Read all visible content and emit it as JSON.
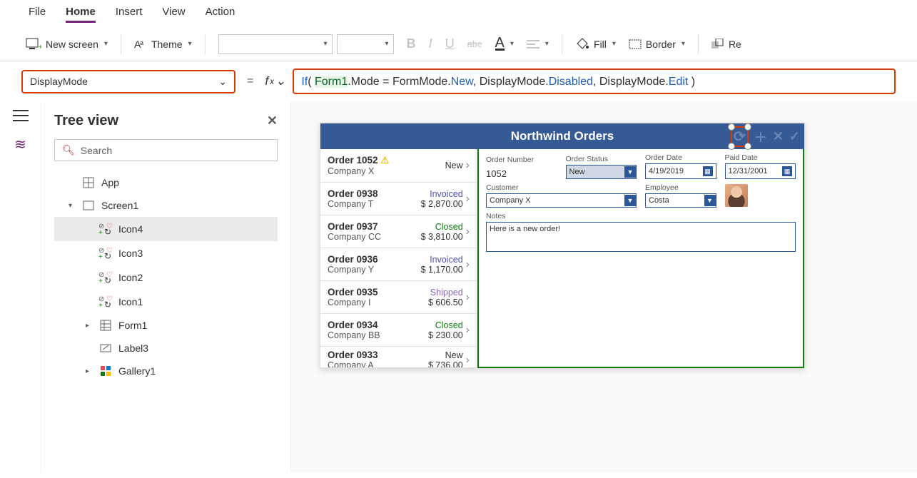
{
  "menu": {
    "items": [
      "File",
      "Home",
      "Insert",
      "View",
      "Action"
    ],
    "activeIndex": 1
  },
  "ribbon": {
    "newScreen": "New screen",
    "theme": "Theme",
    "fill": "Fill",
    "border": "Border",
    "reorder": "Re"
  },
  "formula": {
    "property": "DisplayMode",
    "tokens": [
      {
        "t": "If",
        "c": "kw"
      },
      {
        "t": "( ",
        "c": ""
      },
      {
        "t": "Form1",
        "c": "ref"
      },
      {
        "t": ".Mode = FormMode.",
        "c": ""
      },
      {
        "t": "New",
        "c": "enum"
      },
      {
        "t": ", DisplayMode.",
        "c": ""
      },
      {
        "t": "Disabled",
        "c": "enum"
      },
      {
        "t": ", DisplayMode.",
        "c": ""
      },
      {
        "t": "Edit",
        "c": "enum"
      },
      {
        "t": " )",
        "c": ""
      }
    ]
  },
  "tree": {
    "title": "Tree view",
    "searchPlaceholder": "Search",
    "items": [
      {
        "label": "App",
        "icon": "app",
        "indent": 1
      },
      {
        "label": "Screen1",
        "icon": "screen",
        "indent": 1,
        "caret": "▾"
      },
      {
        "label": "Icon4",
        "icon": "iconctl",
        "indent": 2,
        "selected": true
      },
      {
        "label": "Icon3",
        "icon": "iconctl",
        "indent": 2
      },
      {
        "label": "Icon2",
        "icon": "iconctl",
        "indent": 2
      },
      {
        "label": "Icon1",
        "icon": "iconctl",
        "indent": 2
      },
      {
        "label": "Form1",
        "icon": "form",
        "indent": 2,
        "caret": "▸"
      },
      {
        "label": "Label3",
        "icon": "label",
        "indent": 2
      },
      {
        "label": "Gallery1",
        "icon": "gallery",
        "indent": 2,
        "caret": "▸"
      }
    ]
  },
  "preview": {
    "title": "Northwind Orders",
    "orders": [
      {
        "id": "Order 1052",
        "company": "Company X",
        "status": "New",
        "amount": "",
        "warn": true
      },
      {
        "id": "Order 0938",
        "company": "Company T",
        "status": "Invoiced",
        "amount": "$ 2,870.00"
      },
      {
        "id": "Order 0937",
        "company": "Company CC",
        "status": "Closed",
        "amount": "$ 3,810.00"
      },
      {
        "id": "Order 0936",
        "company": "Company Y",
        "status": "Invoiced",
        "amount": "$ 1,170.00"
      },
      {
        "id": "Order 0935",
        "company": "Company I",
        "status": "Shipped",
        "amount": "$ 606.50"
      },
      {
        "id": "Order 0934",
        "company": "Company BB",
        "status": "Closed",
        "amount": "$ 230.00"
      },
      {
        "id": "Order 0933",
        "company": "Company A",
        "status": "New",
        "amount": "$ 736.00"
      }
    ],
    "form": {
      "orderNumberLabel": "Order Number",
      "orderNumber": "1052",
      "orderStatusLabel": "Order Status",
      "orderStatus": "New",
      "orderDateLabel": "Order Date",
      "orderDate": "4/19/2019",
      "paidDateLabel": "Paid Date",
      "paidDate": "12/31/2001",
      "customerLabel": "Customer",
      "customer": "Company X",
      "employeeLabel": "Employee",
      "employee": "Costa",
      "notesLabel": "Notes",
      "notes": "Here is a new order!"
    }
  }
}
